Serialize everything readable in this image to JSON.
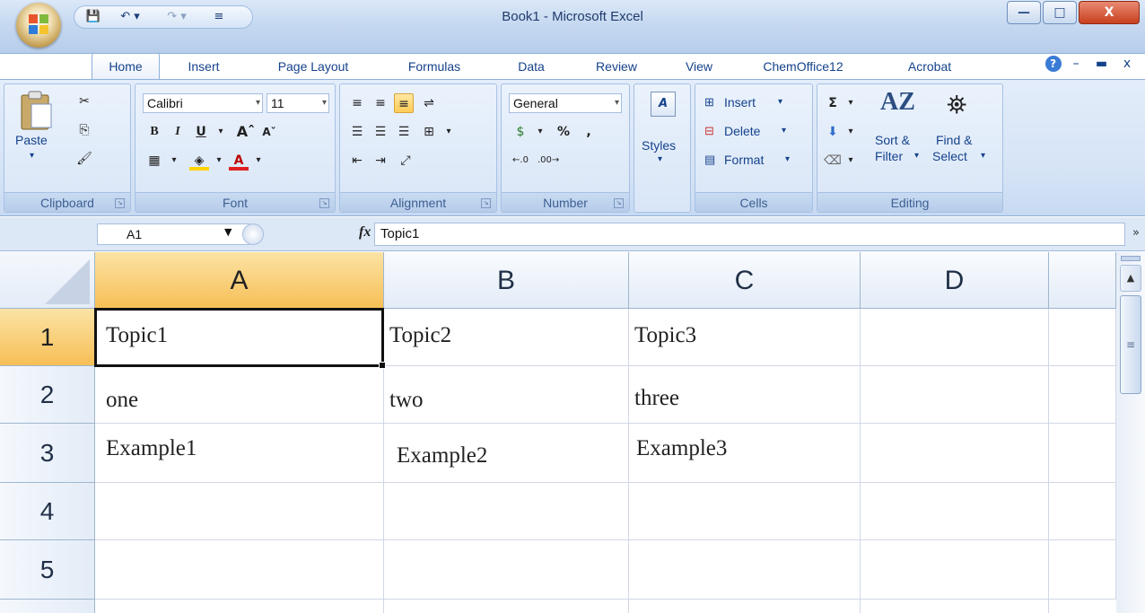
{
  "window": {
    "title": "Book1 - Microsoft Excel",
    "controls": {
      "minimize": "—",
      "maximize": "□",
      "close": "X"
    }
  },
  "qat": {
    "save_icon": "💾",
    "undo": "↶ ▾",
    "redo": "↷ ▾",
    "customize": "≡"
  },
  "tabs": [
    "Home",
    "Insert",
    "Page Layout",
    "Formulas",
    "Data",
    "Review",
    "View",
    "ChemOffice12",
    "Acrobat"
  ],
  "ribbon_controls": {
    "help": "?",
    "minimize": "–",
    "restore": "▬",
    "close": "x"
  },
  "ribbon": {
    "clipboard": {
      "paste": "Paste",
      "label": "Clipboard"
    },
    "font": {
      "name": "Calibri",
      "size": "11",
      "bold": "B",
      "italic": "I",
      "underline": "U",
      "grow": "Aˆ",
      "shrink": "Aˇ",
      "label": "Font"
    },
    "alignment": {
      "label": "Alignment"
    },
    "number": {
      "format": "General",
      "percent": "%",
      "comma": ",",
      "label": "Number"
    },
    "styles": {
      "label": "Styles"
    },
    "cells": {
      "insert": "Insert",
      "delete": "Delete",
      "format": "Format",
      "label": "Cells"
    },
    "editing": {
      "sum": "Σ",
      "sort_filter_1": "Sort &",
      "sort_filter_2": "Filter",
      "find_select_1": "Find &",
      "find_select_2": "Select",
      "label": "Editing"
    }
  },
  "formula_bar": {
    "name_box": "A1",
    "fx": "fx",
    "value": "Topic1"
  },
  "grid": {
    "columns": [
      "A",
      "B",
      "C",
      "D"
    ],
    "rows": [
      "1",
      "2",
      "3",
      "4",
      "5"
    ],
    "cells": [
      [
        "Topic1",
        "Topic2",
        "Topic3",
        ""
      ],
      [
        "one",
        "two",
        "three",
        ""
      ],
      [
        "Example1",
        "Example2",
        "Example3",
        ""
      ],
      [
        "",
        "",
        "",
        ""
      ],
      [
        "",
        "",
        "",
        ""
      ]
    ],
    "active_cell": "A1"
  },
  "colors": {
    "selected_header": "#f7bf56",
    "ribbon_bg": "#d5e3f6",
    "gridline": "#d0d7e5"
  }
}
